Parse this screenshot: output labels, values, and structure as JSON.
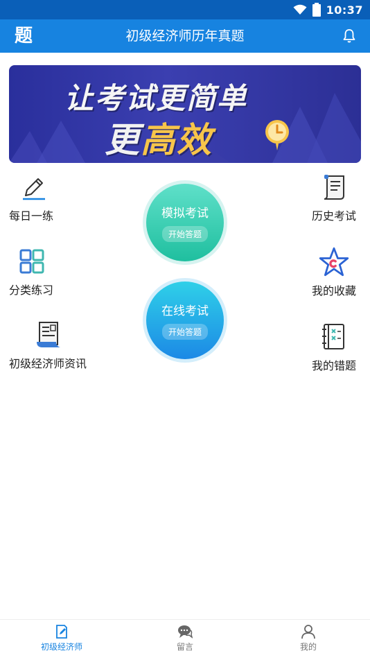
{
  "status_bar": {
    "time": "10:37"
  },
  "header": {
    "logo_char": "题",
    "title": "初级经济师历年真题"
  },
  "banner": {
    "line1": "让考试更简单",
    "line2_white": "更",
    "line2_gold": "高效"
  },
  "left_items": [
    {
      "label": "每日一练",
      "icon": "pencil-icon"
    },
    {
      "label": "分类练习",
      "icon": "category-icon"
    },
    {
      "label": "初级经济师资讯",
      "icon": "news-icon"
    }
  ],
  "right_items": [
    {
      "label": "历史考试",
      "icon": "scroll-icon"
    },
    {
      "label": "我的收藏",
      "icon": "star-icon"
    },
    {
      "label": "我的错题",
      "icon": "wrong-notebook-icon"
    }
  ],
  "mock_exam": {
    "title": "模拟考试",
    "action": "开始答题"
  },
  "online_exam": {
    "title": "在线考试",
    "action": "开始答题"
  },
  "bottom_nav": [
    {
      "label": "初级经济师",
      "icon": "edit-doc-icon",
      "active": true
    },
    {
      "label": "留言",
      "icon": "chat-bubble-icon",
      "active": false
    },
    {
      "label": "我的",
      "icon": "person-icon",
      "active": false
    }
  ],
  "colors": {
    "header": "#1783e0",
    "status_bar": "#0a5fb8",
    "accent": "#1783e0",
    "gold": "#f7c54a"
  }
}
